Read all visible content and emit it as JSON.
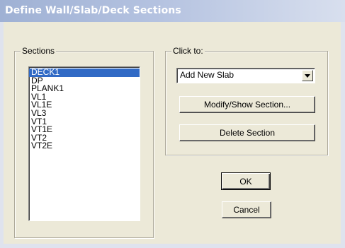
{
  "window": {
    "title": "Define Wall/Slab/Deck Sections"
  },
  "sections_group": {
    "label": "Sections",
    "items": [
      "DECK1",
      "DP",
      "PLANK1",
      "VL1",
      "VL1E",
      "VL3",
      "VT1",
      "VT1E",
      "VT2",
      "VT2E"
    ],
    "selected": "DECK1"
  },
  "click_to_group": {
    "label": "Click to:",
    "dropdown_value": "Add New Slab",
    "modify_button": "Modify/Show Section...",
    "delete_button": "Delete Section"
  },
  "buttons": {
    "ok": "OK",
    "cancel": "Cancel"
  },
  "colors": {
    "selection": "#316ac5",
    "dialog_bg": "#ece9d8"
  },
  "icons": {
    "dropdown_arrow": "chevron-down-icon"
  }
}
